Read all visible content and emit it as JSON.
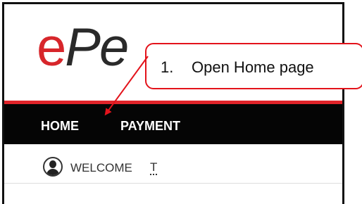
{
  "app": {
    "logo_e": "e",
    "logo_rest": "Pe"
  },
  "nav": {
    "items": [
      {
        "label": "HOME"
      },
      {
        "label": "PAYMENT"
      }
    ]
  },
  "welcome": {
    "label": "WELCOME",
    "user_initial": "T"
  },
  "callout": {
    "number": "1.",
    "text": "Open Home page",
    "color": "#e3131b"
  },
  "colors": {
    "brand_red": "#e1242a",
    "nav_bg": "#050505"
  }
}
